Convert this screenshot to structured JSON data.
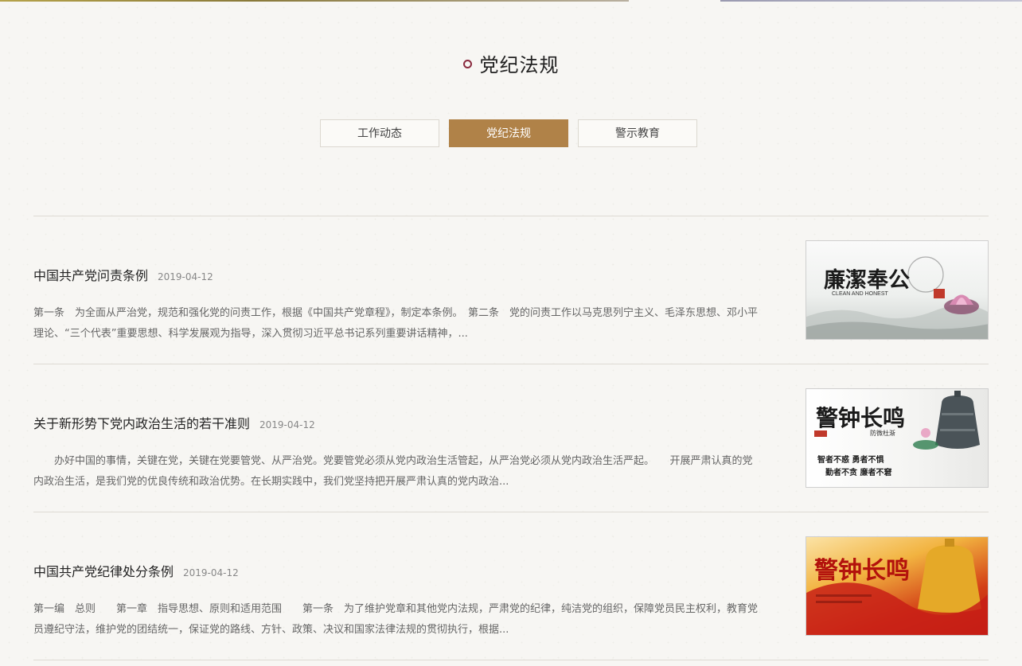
{
  "section": {
    "title": "党纪法规"
  },
  "tabs": [
    {
      "label": "工作动态",
      "active": false
    },
    {
      "label": "党纪法规",
      "active": true
    },
    {
      "label": "警示教育",
      "active": false
    }
  ],
  "articles": [
    {
      "title": "中国共产党问责条例",
      "date": "2019-04-12",
      "excerpt": "第一条　为全面从严治党，规范和强化党的问责工作，根据《中国共产党章程》，制定本条例。　第二条　党的问责工作以马克思列宁主义、毛泽东思想、邓小平理论、“三个代表”重要思想、科学发展观为指导，深入贯彻习近平总书记系列重要讲话精神，...",
      "thumb": {
        "main_text": "廉潔奉公",
        "sub_text": "CLEAN AND HONEST"
      }
    },
    {
      "title": "关于新形势下党内政治生活的若干准则",
      "date": "2019-04-12",
      "excerpt": "　　办好中国的事情，关键在党，关键在党要管党、从严治党。党要管党必须从党内政治生活管起，从严治党必须从党内政治生活严起。　　开展严肃认真的党内政治生活，是我们党的优良传统和政治优势。在长期实践中，我们党坚持把开展严肃认真的党内政治...",
      "thumb": {
        "main_text": "警钟长鸣",
        "sub_text": "防微杜渐",
        "line1": "智者不惑 勇者不惧",
        "line2": "勤者不贪 廉者不窘"
      }
    },
    {
      "title": "中国共产党纪律处分条例",
      "date": "2019-04-12",
      "excerpt": "第一编　总则　　第一章　指导思想、原则和适用范围　　第一条　为了维护党章和其他党内法规，严肃党的纪律，纯洁党的组织，保障党员民主权利，教育党员遵纪守法，维护党的团结统一，保证党的路线、方针、政策、决议和国家法律法规的贯彻执行，根据...",
      "thumb": {
        "main_text": "警钟长鸣"
      }
    }
  ]
}
